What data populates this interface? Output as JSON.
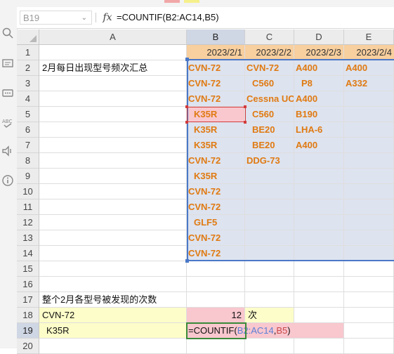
{
  "formula_bar": {
    "name_box": "B19",
    "fx_label": "fx",
    "formula": "=COUNTIF(B2:AC14,B5)"
  },
  "columns": [
    "A",
    "B",
    "C",
    "D",
    "E"
  ],
  "rows": [
    "1",
    "2",
    "3",
    "4",
    "5",
    "6",
    "7",
    "8",
    "9",
    "10",
    "11",
    "12",
    "13",
    "14",
    "15",
    "16",
    "17",
    "18",
    "19",
    "20"
  ],
  "header_dates": [
    "2023/2/1",
    "2023/2/2",
    "2023/2/3",
    "2023/2/4"
  ],
  "summary_title": "2月每日出现型号频次汇总",
  "data": {
    "B": [
      "CVN-72",
      "CVN-72",
      "CVN-72",
      "K35R",
      "K35R",
      "K35R",
      "CVN-72",
      "K35R",
      "CVN-72",
      "CVN-72",
      "GLF5",
      "CVN-72",
      "CVN-72"
    ],
    "C": [
      "CVN-72",
      "C560",
      "Cessna UC",
      "C560",
      "BE20",
      "BE20",
      "DDG-73",
      "",
      "",
      "",
      "",
      "",
      ""
    ],
    "D": [
      "A400",
      "P8",
      "A400",
      "B190",
      "LHA-6",
      "A400",
      "",
      "",
      "",
      "",
      "",
      "",
      ""
    ],
    "E": [
      "A400",
      "A332",
      "",
      "",
      "",
      "",
      "",
      "",
      "",
      "",
      "",
      "",
      ""
    ]
  },
  "count_section": {
    "title": "整个2月各型号被发现的次数",
    "row18_model": "CVN-72",
    "row18_count": "12",
    "row18_unit": "次",
    "row19_model": "K35R",
    "row19_formula_prefix": "=COUNTIF(",
    "row19_formula_range": "B2:AC14",
    "row19_formula_comma": ",",
    "row19_formula_ref": "B5",
    "row19_formula_suffix": ")"
  },
  "left_tools": [
    "search-icon",
    "comment-icon",
    "chat-icon",
    "spellcheck-icon",
    "speaker-icon",
    "info-icon"
  ],
  "colors": {
    "accent_blue": "#4a78c8",
    "orange_text": "#e07a12",
    "date_header": "#f8cf9e",
    "yellow_fill": "#fdfdc9",
    "pink_fill": "#f9c7ce"
  }
}
